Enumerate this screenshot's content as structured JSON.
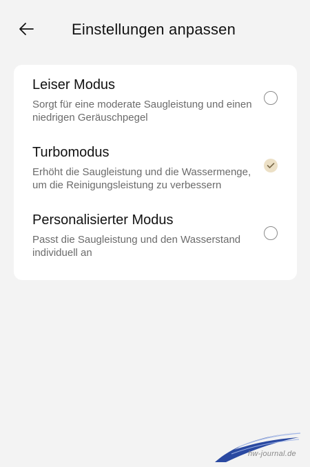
{
  "header": {
    "title": "Einstellungen anpassen",
    "back_icon": "arrow-left-icon"
  },
  "options": [
    {
      "title": "Leiser Modus",
      "description": "Sorgt für eine moderate Saugleistung und einen niedrigen Geräuschpegel",
      "selected": false
    },
    {
      "title": "Turbomodus",
      "description": "Erhöht die Saugleistung und die Wassermenge, um die Reinigungsleistung zu verbessern",
      "selected": true
    },
    {
      "title": "Personalisierter Modus",
      "description": "Passt die Saugleistung und den Wasserstand individuell an",
      "selected": false
    }
  ],
  "colors": {
    "background": "#f3f3f3",
    "card": "#ffffff",
    "selected_fill": "#ece0c6",
    "selected_check": "#7a6a4a",
    "radio_border": "#8a8a8a",
    "description_text": "#6b6b6b",
    "watermark_blue": "#1f3f9c"
  },
  "watermark": {
    "text": "hw-journal.de"
  }
}
